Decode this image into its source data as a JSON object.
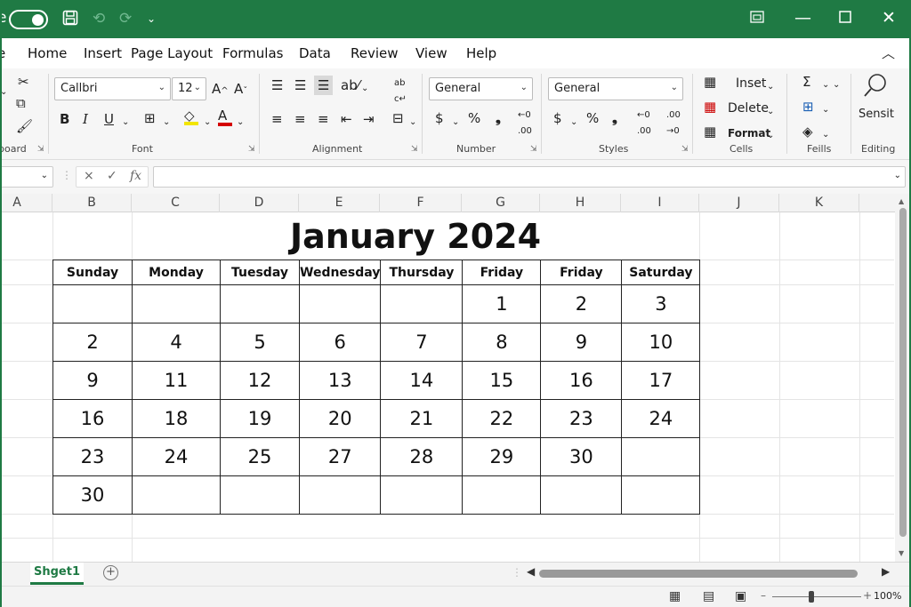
{
  "titlebar": {
    "autosave_cut_label": "e",
    "icons": [
      "toggle-switch",
      "save-icon",
      "undo-icon",
      "redo-icon",
      "customize-dropdown-icon",
      "ribbon-display-icon",
      "minimize-icon",
      "maximize-icon",
      "close-icon"
    ]
  },
  "tabs": [
    "e",
    "Home",
    "Insert",
    "Page Layout",
    "Formulas",
    "Data",
    "Review",
    "View",
    "Help"
  ],
  "ribbon": {
    "clipboard_label": "board",
    "font_label": "Font",
    "font_name": "Callbri",
    "font_size": "12",
    "bold": "B",
    "italic": "I",
    "underline": "U",
    "alignment_label": "Alignment",
    "number_label": "Number",
    "number_format_1": "General",
    "number_format_2": "General",
    "styles_label": "Styles",
    "cells_label": "Cells",
    "insert_label": "Inset",
    "delete_label": "Delete",
    "format_label": "Format",
    "fills_label": "Feills",
    "editing_label": "Editing",
    "sensitivity_label": "Sensit",
    "colors": {
      "highlight": "#f2e500",
      "font_red": "#d40000"
    }
  },
  "formula_bar": {
    "cancel_symbol": "×",
    "enter_symbol": "✓",
    "fx": "fx",
    "value": ""
  },
  "columns": [
    "A",
    "B",
    "C",
    "D",
    "E",
    "F",
    "G",
    "H",
    "I",
    "J",
    "K"
  ],
  "calendar": {
    "title": "January 2024",
    "days": [
      "Sunday",
      "Monday",
      "Tuesday",
      "Wednesday",
      "Thursday",
      "Friday",
      "Friday",
      "Saturday"
    ],
    "weeks": [
      [
        "",
        "",
        "",
        "",
        "",
        "1",
        "2",
        "3"
      ],
      [
        "2",
        "4",
        "5",
        "6",
        "7",
        "8",
        "9",
        "10"
      ],
      [
        "9",
        "11",
        "12",
        "13",
        "14",
        "15",
        "16",
        "17"
      ],
      [
        "16",
        "18",
        "19",
        "20",
        "21",
        "22",
        "23",
        "24"
      ],
      [
        "23",
        "24",
        "25",
        "27",
        "28",
        "29",
        "30",
        ""
      ],
      [
        "30",
        "",
        "",
        "",
        "",
        "",
        "",
        ""
      ]
    ]
  },
  "sheet_tabs": [
    "Shget1"
  ],
  "status": {
    "zoom": "100%"
  },
  "brand_color": "#1f7a44"
}
